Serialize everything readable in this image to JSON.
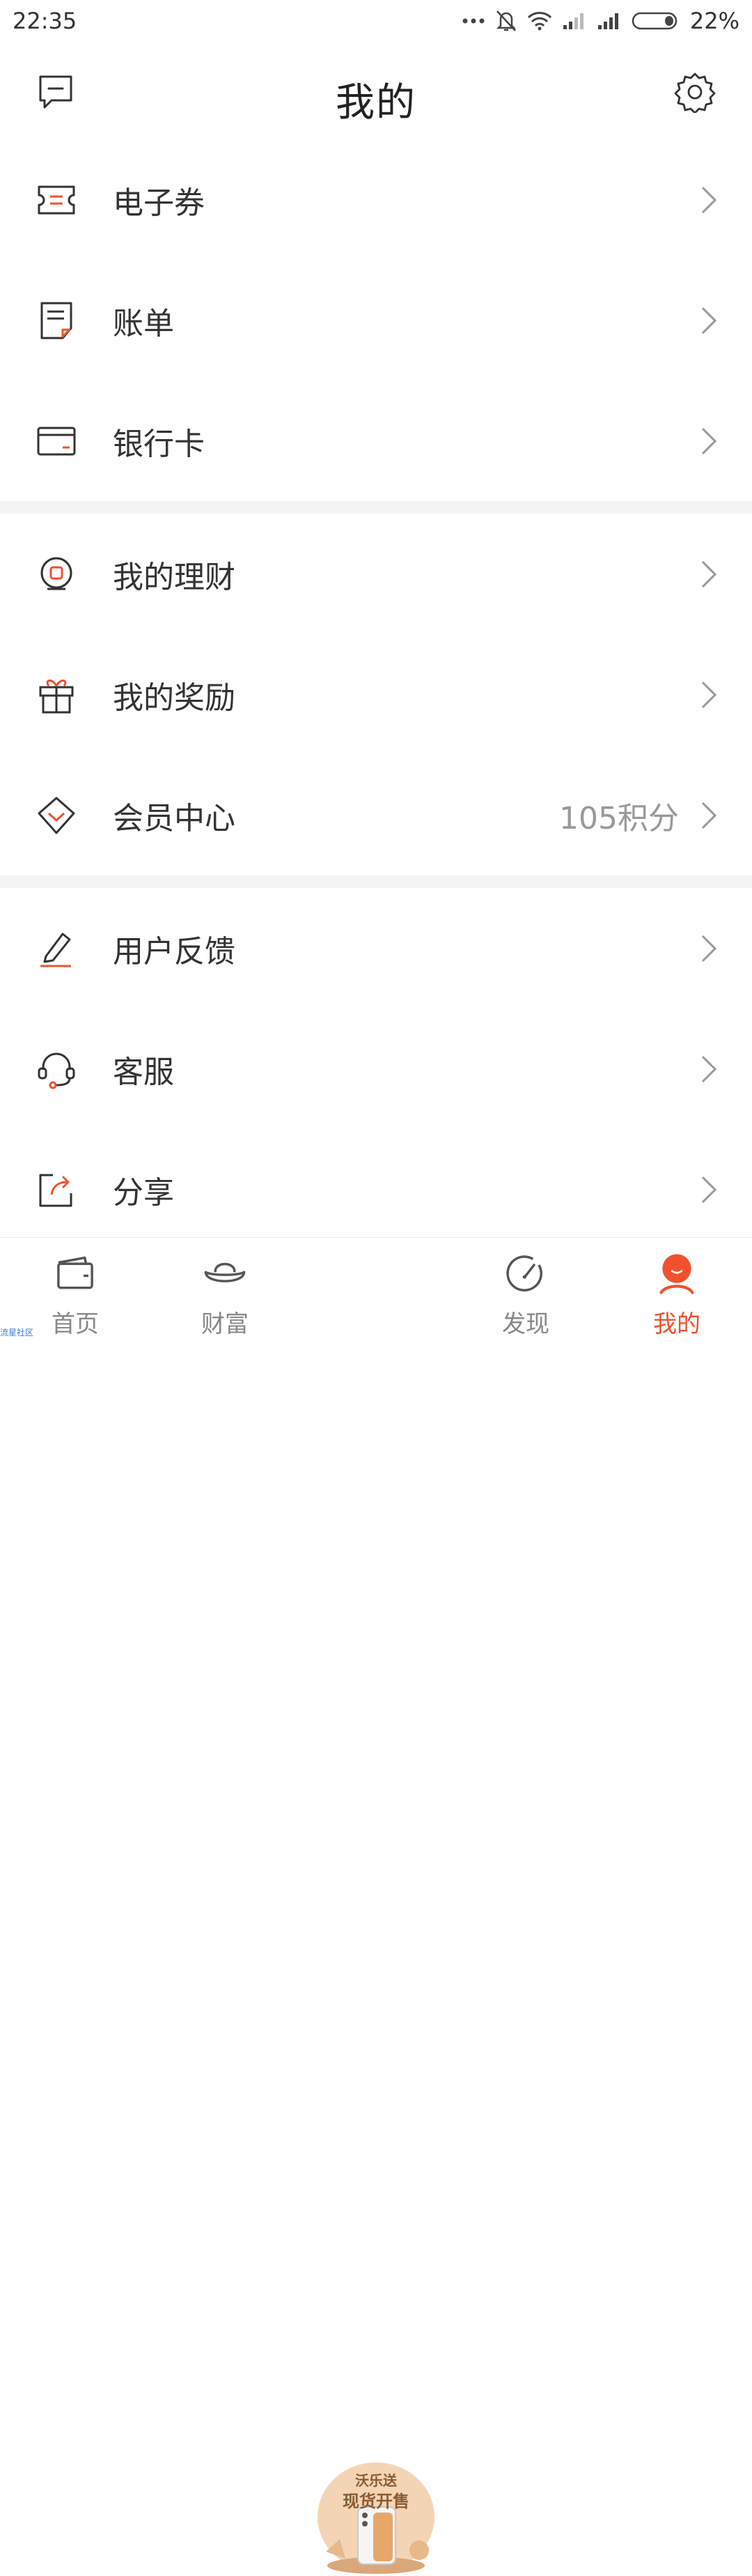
{
  "status_bar": {
    "time": "22:35",
    "battery": "22%",
    "icons": [
      "more-dots-icon",
      "bell-off-icon",
      "wifi-icon",
      "signal-icon",
      "signal-icon",
      "battery-icon"
    ]
  },
  "header": {
    "title": "我的",
    "left_icon": "message-icon",
    "right_icon": "gear-icon"
  },
  "sections": [
    [
      {
        "label": "电子券",
        "icon": "coupon-icon"
      },
      {
        "label": "账单",
        "icon": "bill-icon"
      },
      {
        "label": "银行卡",
        "icon": "bank-card-icon"
      }
    ],
    [
      {
        "label": "我的理财",
        "icon": "finance-icon"
      },
      {
        "label": "我的奖励",
        "icon": "gift-icon"
      },
      {
        "label": "会员中心",
        "icon": "member-diamond-icon",
        "extra": "105积分"
      }
    ],
    [
      {
        "label": "用户反馈",
        "icon": "pencil-icon"
      },
      {
        "label": "客服",
        "icon": "headset-icon"
      },
      {
        "label": "分享",
        "icon": "share-icon"
      }
    ]
  ],
  "tabbar": {
    "tabs": [
      {
        "label": "首页",
        "icon": "wallet-icon"
      },
      {
        "label": "财富",
        "icon": "ingot-icon"
      },
      {
        "label": "发现",
        "icon": "compass-icon"
      },
      {
        "label": "我的",
        "icon": "user-face-icon",
        "active": true
      }
    ],
    "promo": {
      "line1": "沃乐送",
      "line2": "现货开售"
    }
  },
  "watermark": "流星社区",
  "colors": {
    "accent": "#f0502d",
    "icon_stroke": "#333333",
    "separator": "#f4f4f4"
  }
}
